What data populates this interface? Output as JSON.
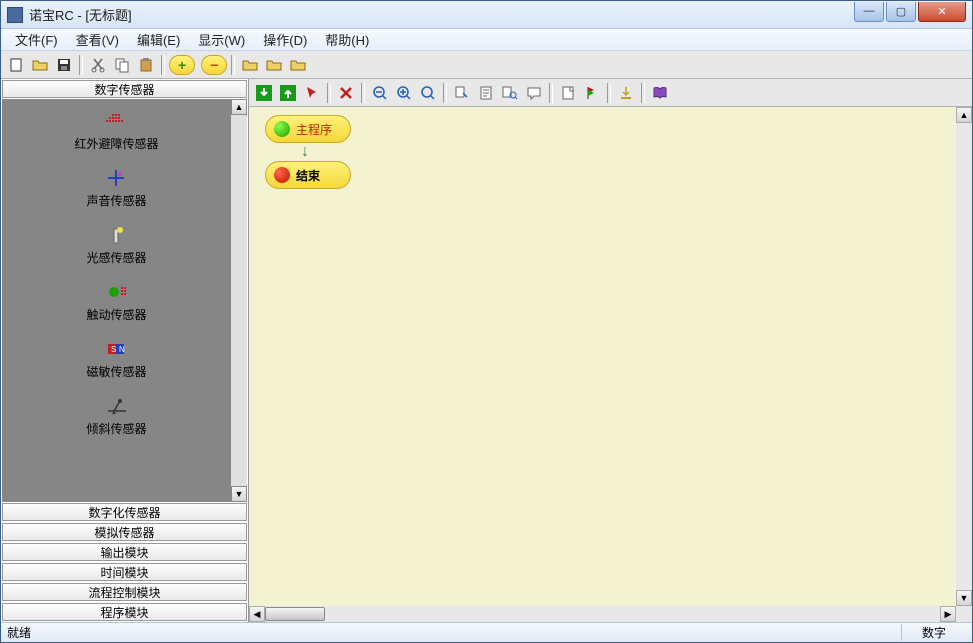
{
  "window": {
    "title": "诺宝RC - [无标题]"
  },
  "menu": {
    "items": [
      "文件(F)",
      "查看(V)",
      "编辑(E)",
      "显示(W)",
      "操作(D)",
      "帮助(H)"
    ]
  },
  "sidebar": {
    "active_header": "数字传感器",
    "sensors": [
      {
        "label": "红外避障传感器",
        "icon": "ir-grid"
      },
      {
        "label": "声音传感器",
        "icon": "sound-cross"
      },
      {
        "label": "光感传感器",
        "icon": "light-bulb"
      },
      {
        "label": "触动传感器",
        "icon": "touch-dot"
      },
      {
        "label": "磁敏传感器",
        "icon": "magnet"
      },
      {
        "label": "倾斜传感器",
        "icon": "tilt-lever"
      }
    ],
    "categories": [
      "数字化传感器",
      "模拟传感器",
      "输出模块",
      "时间模块",
      "流程控制模块",
      "程序模块"
    ]
  },
  "canvas": {
    "nodes": {
      "start": {
        "label": "主程序"
      },
      "end": {
        "label": "结束"
      }
    }
  },
  "status": {
    "left": "就绪",
    "right": "数字"
  }
}
